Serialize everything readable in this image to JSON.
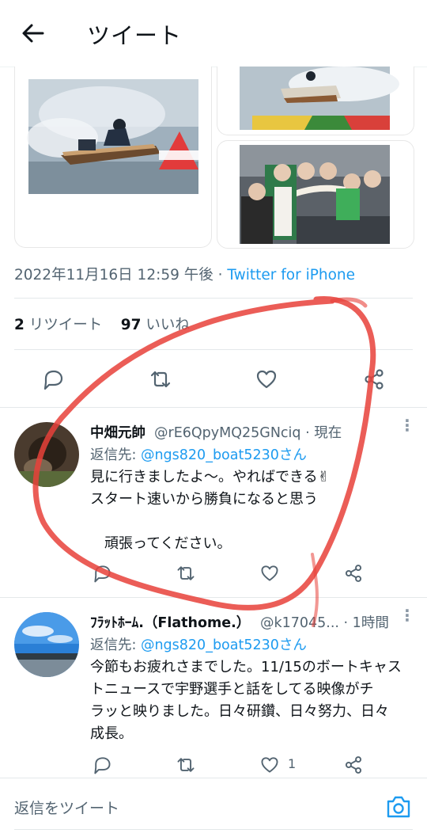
{
  "header": {
    "title": "ツイート",
    "back_icon": "arrow-left-icon"
  },
  "tweet": {
    "timestamp": "2022年11月16日 12:59 午後 · ",
    "source": "Twitter for iPhone",
    "stats": {
      "retweets": "2",
      "retweets_label": " リツイート",
      "likes": "97",
      "likes_label": " いいね"
    },
    "actions": [
      "reply-icon",
      "retweet-icon",
      "like-icon",
      "share-icon"
    ]
  },
  "replies": [
    {
      "name": "中畑元帥",
      "handle": "@rE6QpyMQ25GNciq · 現在",
      "reply_label": "返信先: ",
      "reply_to": "@ngs820_boat5230さん",
      "text": "見に行きましたよ～。やればできる✌\nスタート速いから勝負になると思う\n\n　頑張ってください。",
      "like_count": ""
    },
    {
      "name": "ﾌﾗｯﾄﾎｰﾑ.（Flathome.）",
      "handle": "@k17045... · 1時間",
      "reply_label": "返信先: ",
      "reply_to": "@ngs820_boat5230さん",
      "text": "今節もお疲れさまでした。11/15のボートキャス\nトニュースで宇野選手と話をしてる映像がチ\nラッと映りました。日々研鑽、日々努力、日々\n成長。",
      "like_count": "1"
    }
  ],
  "composer": {
    "placeholder": "返信をツイート",
    "camera_icon": "camera-icon"
  },
  "colors": {
    "accent": "#1d9bf0",
    "secondary_text": "#536471",
    "annotation": "#e8413a"
  }
}
